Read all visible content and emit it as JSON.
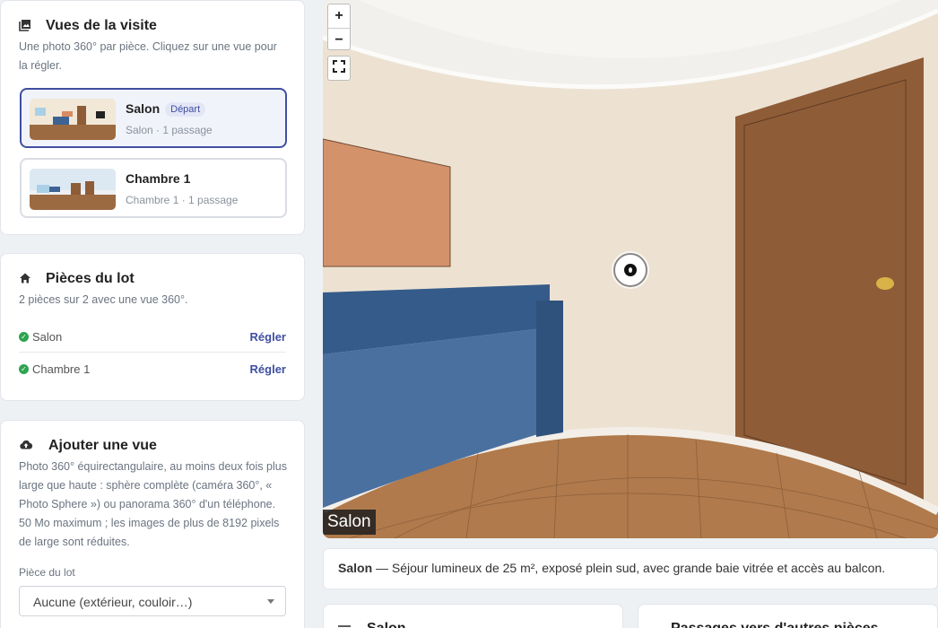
{
  "views": {
    "title": "Vues de la visite",
    "icon": "photo-library-icon",
    "description": "Une photo 360° par pièce. Cliquez sur une vue pour la régler.",
    "items": [
      {
        "name": "Salon",
        "badge": "Départ",
        "subtitle": "Salon · 1 passage",
        "active": true
      },
      {
        "name": "Chambre 1",
        "badge": "",
        "subtitle": "Chambre 1 · 1 passage",
        "active": false
      }
    ]
  },
  "rooms": {
    "title": "Pièces du lot",
    "icon": "home-icon",
    "summary": "2 pièces sur 2 avec une vue 360°.",
    "items": [
      {
        "name": "Salon",
        "action": "Régler"
      },
      {
        "name": "Chambre 1",
        "action": "Régler"
      }
    ]
  },
  "add_view": {
    "title": "Ajouter une vue",
    "icon": "cloud-upload-icon",
    "description": "Photo 360° équirectangulaire, au moins deux fois plus large que haute : sphère complète (caméra 360°, « Photo Sphere ») ou panorama 360° d'un téléphone. 50 Mo maximum ; les images de plus de 8192 pixels de large sont réduites.",
    "field_label": "Pièce du lot",
    "select_value": "Aucune (extérieur, couloir…)"
  },
  "viewer": {
    "zoom_in": "+",
    "zoom_out": "−",
    "scene_label": "Salon"
  },
  "caption": {
    "room": "Salon",
    "text": " — Séjour lumineux de 25 m², exposé plein sud, avec grande baie vitrée et accès au balcon."
  },
  "bottom": {
    "left_title": "Salon",
    "right_title": "Passages vers d'autres pièces"
  },
  "colors": {
    "accent": "#3f4fa1",
    "check": "#2ea44f",
    "wall": "#ede2d2",
    "door": "#8f5c38",
    "sofa": "#3d6394",
    "floor": "#b07a4c"
  }
}
